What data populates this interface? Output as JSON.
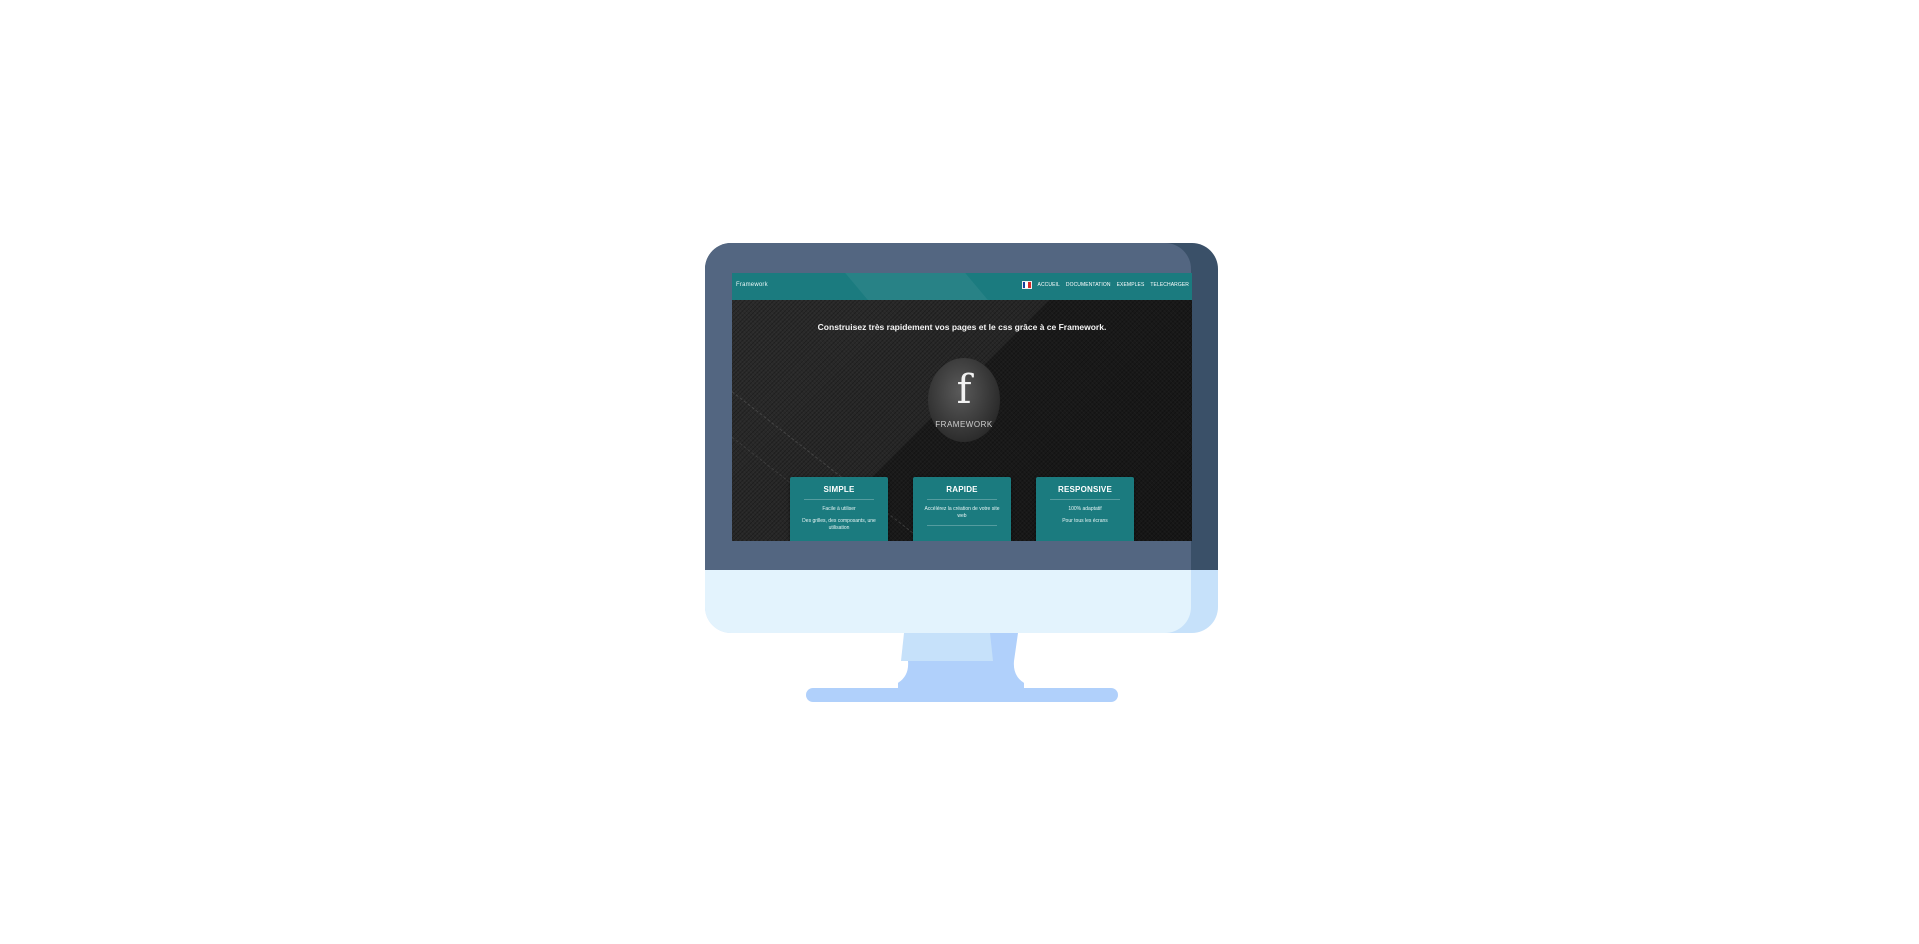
{
  "navbar": {
    "brand": "Framework",
    "language_flag_icon": "france-flag-icon",
    "links": [
      "Accueil",
      "Documentation",
      "Exemples",
      "Telecharger"
    ]
  },
  "hero": {
    "headline": "Construisez très rapidement vos pages et le css grâce à ce Framework.",
    "logo_letter": "f",
    "logo_text": "FRAMEWORK"
  },
  "cards": [
    {
      "title": "Simple",
      "subtitle": "Facile à utiliser",
      "text": "Des grilles, des composants, une utilisation"
    },
    {
      "title": "Rapide",
      "subtitle": "Accélérez la création de votre site web",
      "text": ""
    },
    {
      "title": "Responsive",
      "subtitle": "100% adaptatif",
      "text": "Pour tous les écrans"
    }
  ],
  "colors": {
    "accent": "#1b7b7f",
    "bezel": "#536681",
    "bezel_shadow": "#3a5068",
    "chin": "#e3f3fd",
    "stand": "#b0d0fb"
  }
}
